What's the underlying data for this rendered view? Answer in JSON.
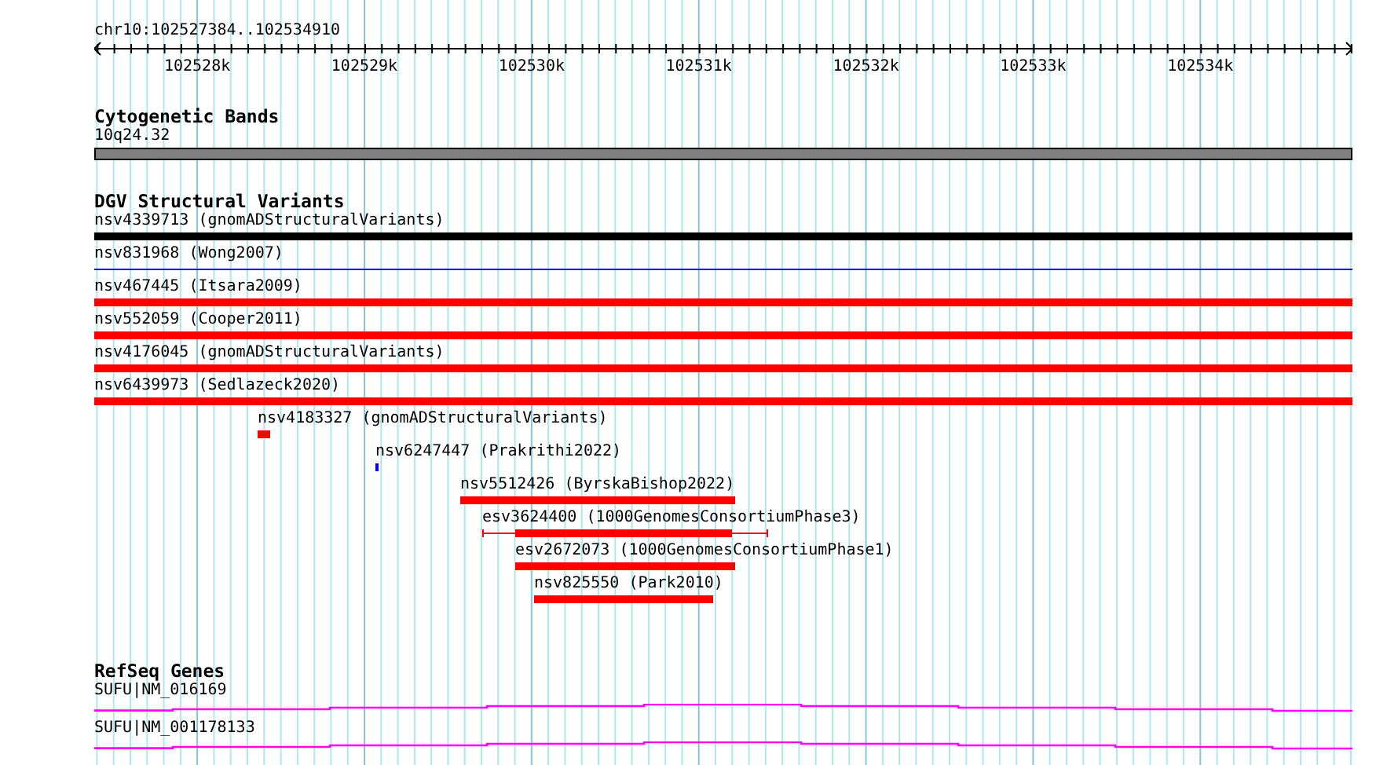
{
  "ruler": {
    "location": "chr10:102527384..102534910",
    "ticks": [
      "102528k",
      "102529k",
      "102530k",
      "102531k",
      "102532k",
      "102533k",
      "102534k"
    ]
  },
  "tracks": [
    {
      "title": "Cytogenetic Bands",
      "kind": "band",
      "features": [
        {
          "label": "10q24.32",
          "color": "#808080"
        }
      ]
    },
    {
      "title": "DGV Structural Variants",
      "kind": "variants",
      "features": [
        {
          "label": "nsv4339713 (gnomADStructuralVariants)",
          "kind": "bar",
          "color": "#000000"
        },
        {
          "label": "nsv831968 (Wong2007)",
          "kind": "line",
          "color": "#0000ff"
        },
        {
          "label": "nsv467445 (Itsara2009)",
          "kind": "bar",
          "color": "#ff0000"
        },
        {
          "label": "nsv552059 (Cooper2011)",
          "kind": "bar",
          "color": "#ff0000"
        },
        {
          "label": "nsv4176045 (gnomADStructuralVariants)",
          "kind": "bar",
          "color": "#ff0000"
        },
        {
          "label": "nsv6439973 (Sedlazeck2020)",
          "kind": "bar",
          "color": "#ff0000"
        },
        {
          "label": "nsv4183327 (gnomADStructuralVariants)",
          "kind": "bar",
          "color": "#ff0000"
        },
        {
          "label": "nsv6247447 (Prakrithi2022)",
          "kind": "bar",
          "color": "#0000ff"
        },
        {
          "label": "nsv5512426 (ByrskaBishop2022)",
          "kind": "bar",
          "color": "#ff0000"
        },
        {
          "label": "esv3624400 (1000GenomesConsortiumPhase3)",
          "kind": "whisker",
          "color": "#ff0000"
        },
        {
          "label": "esv2672073 (1000GenomesConsortiumPhase1)",
          "kind": "bar",
          "color": "#ff0000"
        },
        {
          "label": "nsv825550 (Park2010)",
          "kind": "bar",
          "color": "#ff0000"
        }
      ]
    },
    {
      "title": "RefSeq Genes",
      "kind": "genes",
      "features": [
        {
          "label": "SUFU|NM_016169",
          "color": "#ff00ff"
        },
        {
          "label": "SUFU|NM_001178133",
          "color": "#ff00ff"
        }
      ]
    }
  ]
}
